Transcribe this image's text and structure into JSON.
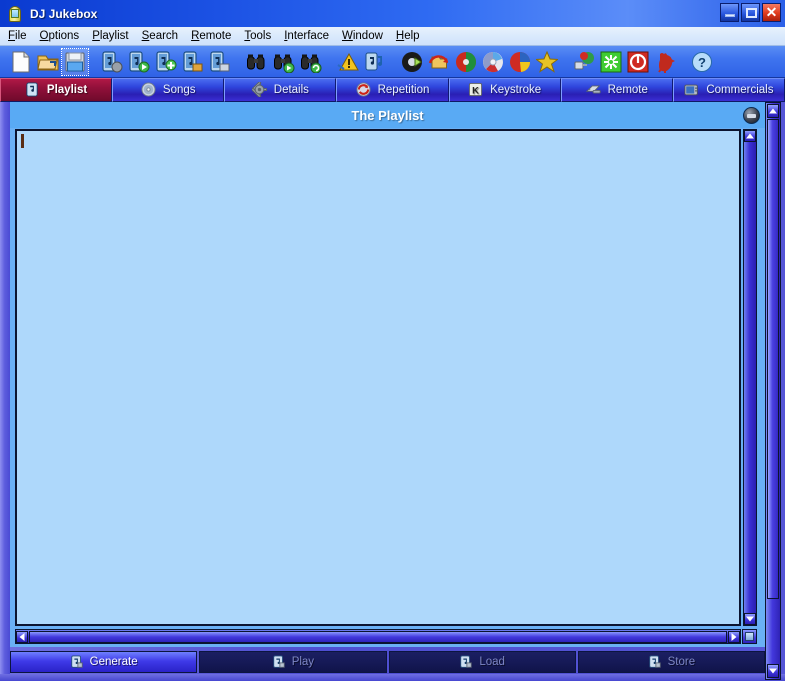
{
  "window": {
    "title": "DJ Jukebox",
    "app_icon": "jukebox-icon",
    "controls": {
      "minimize": "minimize-button",
      "maximize": "maximize-button",
      "close_glyph": "✕"
    },
    "accent_colors": {
      "titlebar_blue": "#1c52e4",
      "active_tab_maroon": "#91103a",
      "pane_blue": "#59aaf4",
      "editor_blue": "#aed8fb",
      "enabled_button": "#3f3ae8",
      "disabled_button": "#161a57",
      "close_red": "#df3a1d"
    }
  },
  "menubar": {
    "items": [
      {
        "label": "File",
        "mnemonic": "F"
      },
      {
        "label": "Options",
        "mnemonic": "O"
      },
      {
        "label": "Playlist",
        "mnemonic": "P"
      },
      {
        "label": "Search",
        "mnemonic": "S"
      },
      {
        "label": "Remote",
        "mnemonic": "R"
      },
      {
        "label": "Tools",
        "mnemonic": "T"
      },
      {
        "label": "Interface",
        "mnemonic": "I"
      },
      {
        "label": "Window",
        "mnemonic": "W"
      },
      {
        "label": "Help",
        "mnemonic": "H"
      }
    ]
  },
  "toolbar": {
    "buttons": [
      {
        "name": "new-document-icon",
        "selected": false,
        "group_start": false
      },
      {
        "name": "open-folder-icon",
        "selected": false,
        "group_start": false
      },
      {
        "name": "save-floppy-icon",
        "selected": true,
        "group_start": false
      },
      {
        "name": "song-settings-icon",
        "selected": false,
        "group_start": true
      },
      {
        "name": "song-play-icon",
        "selected": false,
        "group_start": false
      },
      {
        "name": "song-add-icon",
        "selected": false,
        "group_start": false
      },
      {
        "name": "song-folder-icon",
        "selected": false,
        "group_start": false
      },
      {
        "name": "song-disk-icon",
        "selected": false,
        "group_start": false
      },
      {
        "name": "search-binoculars-icon",
        "selected": false,
        "group_start": true
      },
      {
        "name": "search-next-icon",
        "selected": false,
        "group_start": false
      },
      {
        "name": "search-refresh-icon",
        "selected": false,
        "group_start": false
      },
      {
        "name": "warning-triangle-icon",
        "selected": false,
        "group_start": true
      },
      {
        "name": "music-note-icon",
        "selected": false,
        "group_start": false
      },
      {
        "name": "disc-eject-icon",
        "selected": false,
        "group_start": true
      },
      {
        "name": "folder-refresh-icon",
        "selected": false,
        "group_start": false
      },
      {
        "name": "cd-red-icon",
        "selected": false,
        "group_start": false
      },
      {
        "name": "cd-rainbow-icon",
        "selected": false,
        "group_start": false
      },
      {
        "name": "pie-chart-icon",
        "selected": false,
        "group_start": false
      },
      {
        "name": "star-icon",
        "selected": false,
        "group_start": false
      },
      {
        "name": "plug-icon",
        "selected": false,
        "group_start": true
      },
      {
        "name": "sparkle-green-icon",
        "selected": false,
        "group_start": false
      },
      {
        "name": "power-off-icon",
        "selected": false,
        "group_start": false
      },
      {
        "name": "rooster-icon",
        "selected": false,
        "group_start": false
      },
      {
        "name": "help-question-icon",
        "selected": false,
        "group_start": true
      }
    ]
  },
  "tabs": [
    {
      "label": "Playlist",
      "icon": "playlist-note-icon",
      "active": true
    },
    {
      "label": "Songs",
      "icon": "cd-disc-icon",
      "active": false
    },
    {
      "label": "Details",
      "icon": "gear-icon",
      "active": false
    },
    {
      "label": "Repetition",
      "icon": "repeat-icon",
      "active": false
    },
    {
      "label": "Keystroke",
      "icon": "keyboard-key-icon",
      "active": false
    },
    {
      "label": "Remote",
      "icon": "remote-control-icon",
      "active": false
    },
    {
      "label": "Commercials",
      "icon": "tv-icon",
      "active": false
    }
  ],
  "pane": {
    "header": "The Playlist",
    "header_button": "options-dot-button",
    "editor": {
      "value": "",
      "placeholder": "",
      "caret_visible": true
    },
    "scrollbars": {
      "vertical_up": "▲",
      "vertical_down": "▼",
      "horizontal_left": "◄",
      "horizontal_right": "►",
      "resize_corner": "resize-corner-icon"
    }
  },
  "bottom_buttons": [
    {
      "label": "Generate",
      "icon": "generate-icon",
      "enabled": true
    },
    {
      "label": "Play",
      "icon": "play-icon",
      "enabled": false
    },
    {
      "label": "Load",
      "icon": "load-icon",
      "enabled": false
    },
    {
      "label": "Store",
      "icon": "store-icon",
      "enabled": false
    }
  ]
}
